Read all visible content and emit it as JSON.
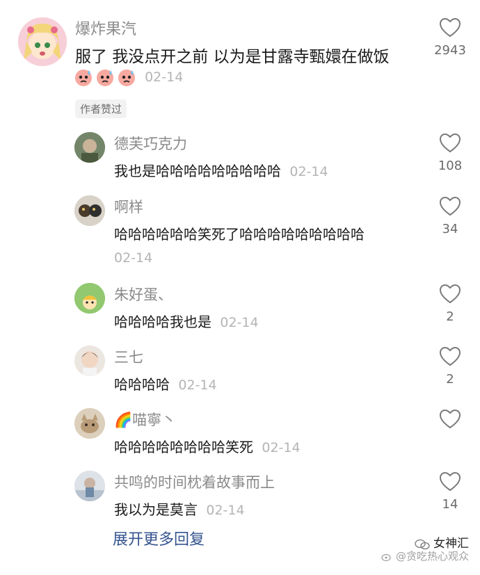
{
  "top_comment": {
    "username": "爆炸果汽",
    "text": "服了 我没点开之前 以为是甘露寺甄嬛在做饭",
    "time": "02-14",
    "likes": "2943",
    "badge": "作者赞过",
    "emoji_count": 3
  },
  "replies": [
    {
      "username": "德芙巧克力",
      "text": "我也是哈哈哈哈哈哈哈哈哈",
      "time": "02-14",
      "likes": "108"
    },
    {
      "username": "啊样",
      "text": "哈哈哈哈哈哈笑死了哈哈哈哈哈哈哈哈哈",
      "time": "02-14",
      "likes": "34"
    },
    {
      "username": "朱好蛋、",
      "text": "哈哈哈哈我也是",
      "time": "02-14",
      "likes": "2"
    },
    {
      "username": "三七",
      "text": "哈哈哈哈",
      "time": "02-14",
      "likes": "2"
    },
    {
      "username": "🌈喵寧丶",
      "text": "哈哈哈哈哈哈哈哈笑死",
      "time": "02-14",
      "likes": ""
    },
    {
      "username": "共鸣的时间枕着故事而上",
      "text": "我以为是莫言",
      "time": "02-14",
      "likes": "14"
    }
  ],
  "more_replies": "展开更多回复",
  "watermark": {
    "brand": "女神汇",
    "sub": "@贪吃热心观众"
  },
  "colors": {
    "link": "#35548f",
    "username": "#8a8a8a",
    "time": "#b4b4b4"
  }
}
